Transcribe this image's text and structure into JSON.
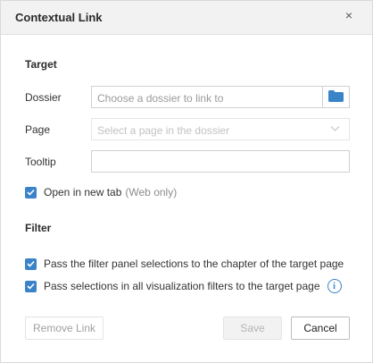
{
  "dialog": {
    "title": "Contextual Link",
    "close_glyph": "×"
  },
  "target": {
    "heading": "Target",
    "dossier_label": "Dossier",
    "dossier_placeholder": "Choose a dossier to link to",
    "page_label": "Page",
    "page_placeholder": "Select a page in the dossier",
    "tooltip_label": "Tooltip",
    "tooltip_value": "",
    "open_new_tab_label": "Open in new tab",
    "open_new_tab_note": "(Web only)",
    "open_new_tab_checked": true
  },
  "filter": {
    "heading": "Filter",
    "option1_label": "Pass the filter panel selections to the chapter of the target page",
    "option1_checked": true,
    "option2_label": "Pass selections in all visualization filters to the target page",
    "option2_checked": true
  },
  "buttons": {
    "remove_link": "Remove Link",
    "save": "Save",
    "cancel": "Cancel"
  },
  "icons": {
    "folder": "folder-icon",
    "chevron": "chevron-down-icon",
    "info": "info-icon",
    "check": "checkmark-icon"
  },
  "colors": {
    "accent": "#3a83c8",
    "header_bg": "#f2f2f2"
  }
}
